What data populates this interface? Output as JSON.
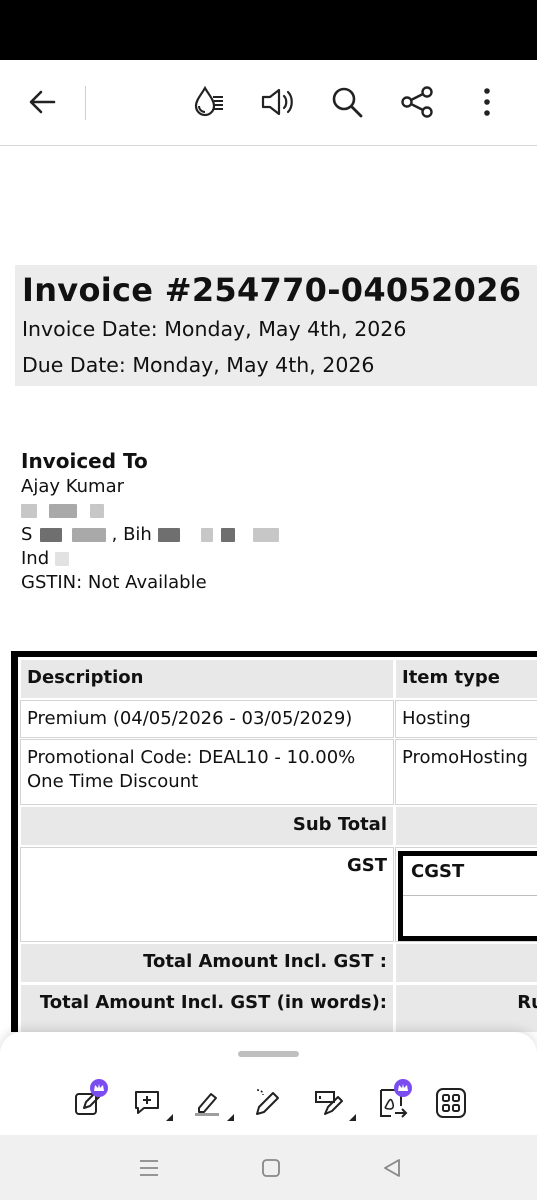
{
  "toolbar": {
    "icons": [
      "back-arrow-icon",
      "reading-mode-icon",
      "speaker-icon",
      "search-icon",
      "share-icon",
      "more-options-icon"
    ]
  },
  "invoice": {
    "title": "Invoice #254770-04052026",
    "invoice_date": "Invoice Date: Monday, May 4th, 2026",
    "due_date": "Due Date: Monday, May 4th, 2026"
  },
  "invoiced_to": {
    "heading": "Invoiced To",
    "name": "Ajay Kumar",
    "line_address_prefix": "S",
    "line_city_fragment": ", Bih",
    "line_country": "Ind",
    "gstin": "GSTIN: Not Available"
  },
  "table": {
    "headers": {
      "description": "Description",
      "item_type": "Item type"
    },
    "rows": [
      {
        "description": "Premium (04/05/2026 - 03/05/2029)",
        "item_type": "Hosting"
      },
      {
        "description": "Promotional Code: DEAL10 - 10.00% One Time Discount",
        "item_type": "PromoHosting"
      }
    ],
    "sub_total_label": "Sub Total",
    "gst_label": "GST",
    "cgst_label": "CGST",
    "total_label": "Total Amount Incl. GST :",
    "total_words_label": "Total Amount Incl. GST (in words):",
    "total_words_value": "Rupe"
  },
  "bottom_tools": [
    "edit-premium-icon",
    "add-comment-icon",
    "highlighter-icon",
    "pen-icon",
    "sign-icon",
    "convert-pdf-premium-icon",
    "grid-menu-icon"
  ],
  "nav": [
    "recents-icon",
    "home-icon",
    "back-icon"
  ],
  "colors": {
    "premium_badge": "#7b4df0",
    "header_bg": "#ececec",
    "table_grey": "#e8e8e8"
  }
}
